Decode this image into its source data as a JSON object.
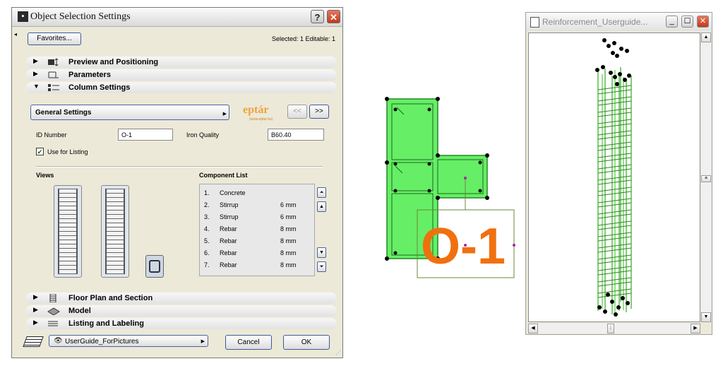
{
  "dialog": {
    "title": "Object Selection Settings",
    "help_label": "?",
    "close_label": "✕",
    "favorites_label": "Favorites...",
    "selected_info": "Selected: 1 Editable: 1",
    "sections_top": [
      {
        "label": "Preview and Positioning",
        "expanded": false
      },
      {
        "label": "Parameters",
        "expanded": false
      },
      {
        "label": "Column Settings",
        "expanded": true
      }
    ],
    "general_settings_label": "General Settings",
    "logo_text": "eptár",
    "logo_sub": "(www.eptar.hu)",
    "nav_prev": "<<",
    "nav_next": ">>",
    "id_label": "ID Number",
    "id_value": "O-1",
    "iron_label": "Iron Quality",
    "iron_value": "B60.40",
    "listing_checkbox_label": "Use for Listing",
    "listing_checked": true,
    "views_label": "Views",
    "component_list_label": "Component List",
    "components": [
      {
        "num": "1.",
        "name": "Concrete",
        "size": ""
      },
      {
        "num": "2.",
        "name": "Stirrup",
        "size": "6 mm"
      },
      {
        "num": "3.",
        "name": "Stirrup",
        "size": "6 mm"
      },
      {
        "num": "4.",
        "name": "Rebar",
        "size": "8 mm"
      },
      {
        "num": "5.",
        "name": "Rebar",
        "size": "8 mm"
      },
      {
        "num": "6.",
        "name": "Rebar",
        "size": "8 mm"
      },
      {
        "num": "7.",
        "name": "Rebar",
        "size": "8 mm"
      }
    ],
    "sections_bottom": [
      {
        "label": "Floor Plan and Section",
        "expanded": false
      },
      {
        "label": "Model",
        "expanded": false
      },
      {
        "label": "Listing and Labeling",
        "expanded": false
      }
    ],
    "layer_value": "UserGuide_ForPictures",
    "cancel_label": "Cancel",
    "ok_label": "OK"
  },
  "drawing": {
    "label": "O-1",
    "fill_color": "#66ee66",
    "label_color": "#f07010"
  },
  "window3d": {
    "title": "Reinforcement_Userguide..."
  },
  "colors": {
    "dialog_bg": "#ece9d8",
    "accent_border": "#3c5a9a",
    "rebar_green": "#33aa22"
  }
}
